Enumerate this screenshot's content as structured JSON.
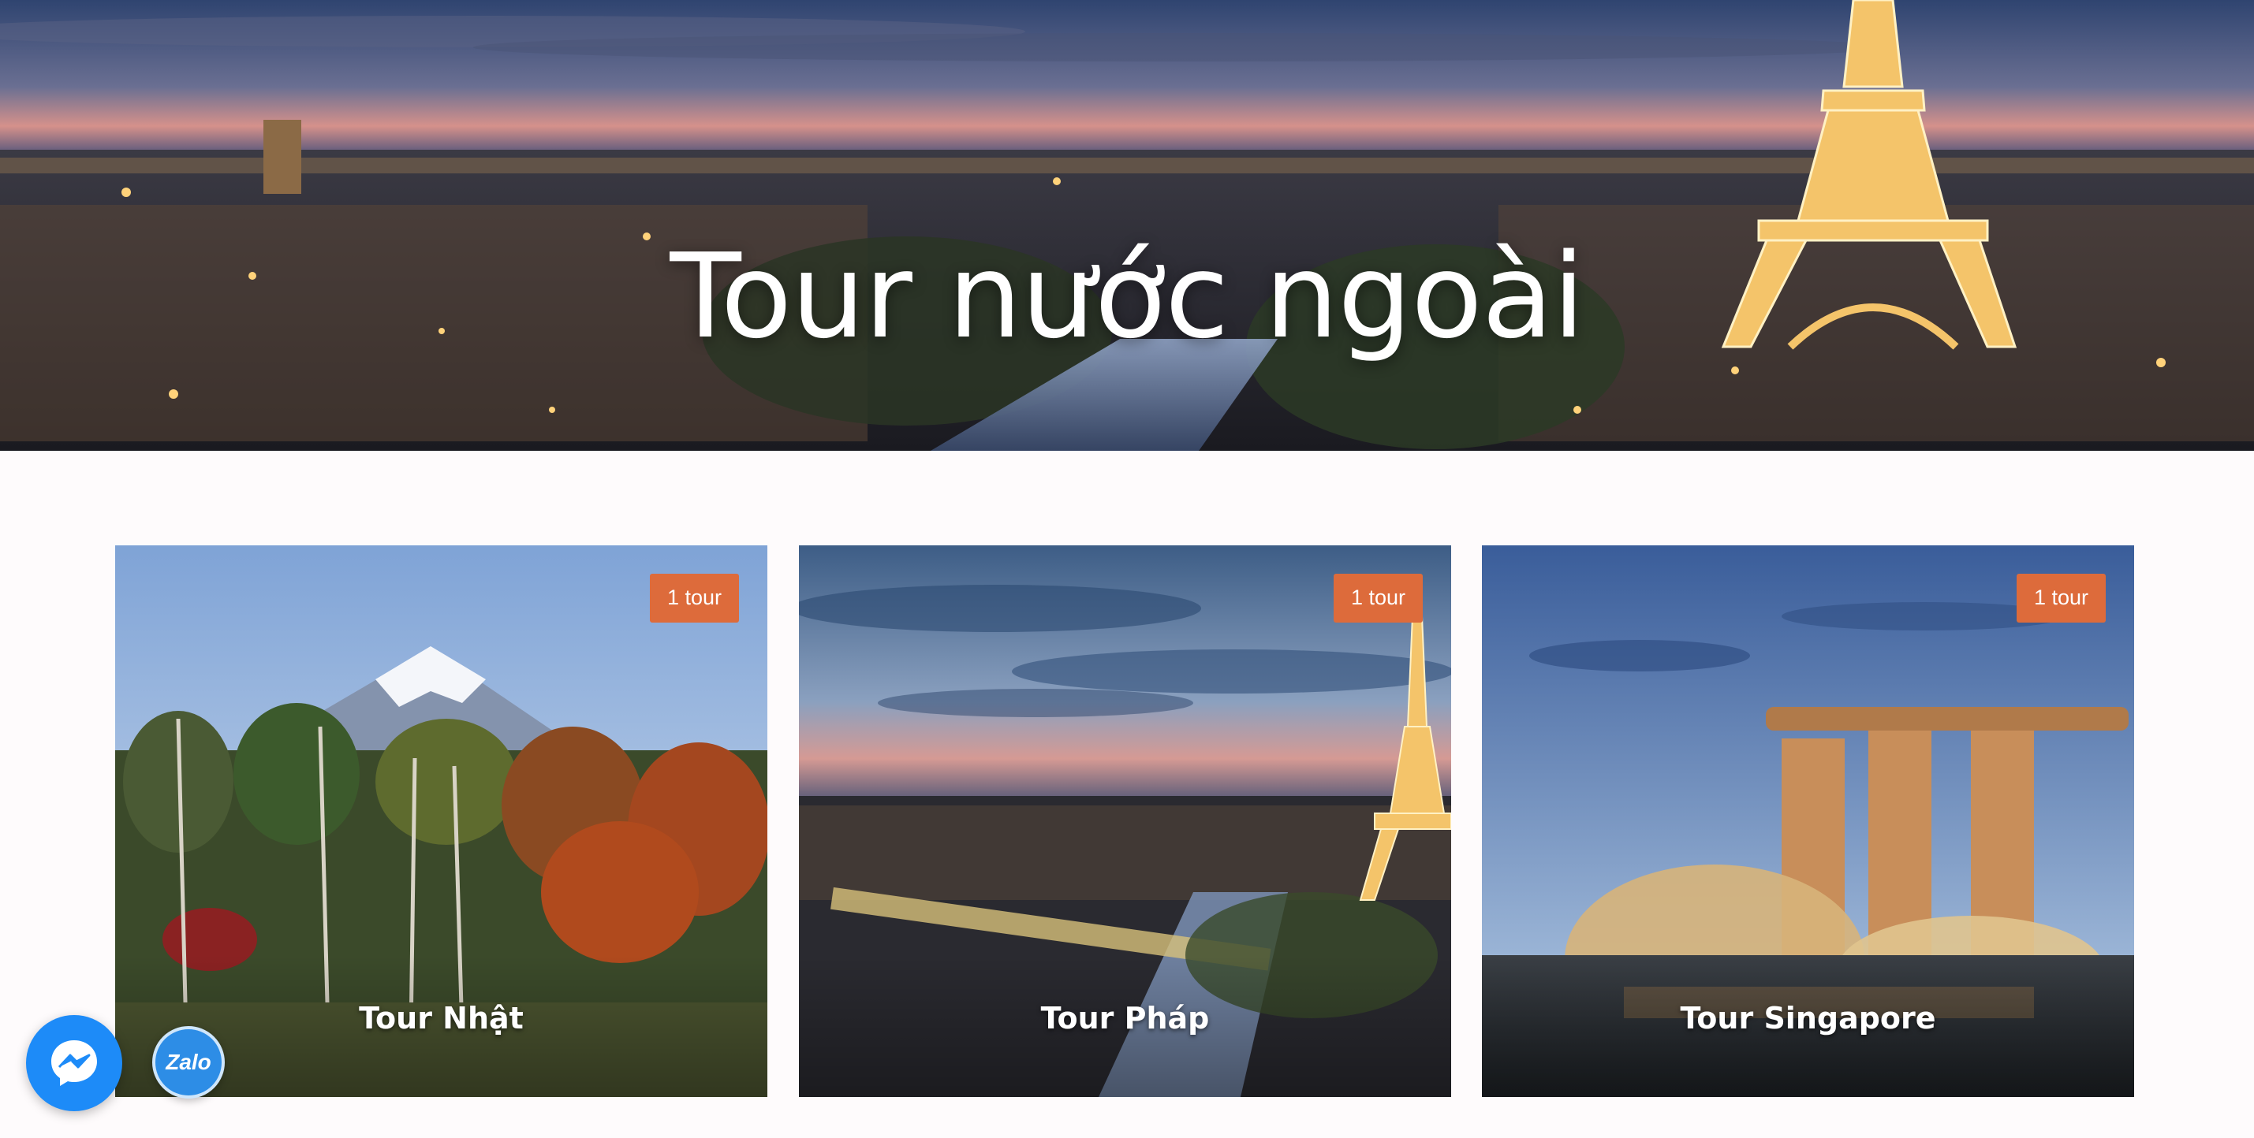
{
  "hero": {
    "title": "Tour nước ngoài",
    "image_icon": "paris-skyline-image"
  },
  "cards": [
    {
      "title": "Tour Nhật",
      "badge": "1 tour",
      "image_icon": "mount-fuji-image"
    },
    {
      "title": "Tour Pháp",
      "badge": "1 tour",
      "image_icon": "eiffel-tower-image"
    },
    {
      "title": "Tour Singapore",
      "badge": "1 tour",
      "image_icon": "marina-bay-sands-image"
    }
  ],
  "floating": {
    "messenger_icon": "messenger-icon",
    "zalo_label": "Zalo"
  },
  "colors": {
    "badge": "#dd6b3b",
    "page_background": "#fefbfc",
    "messenger": "#1d8bf8",
    "zalo": "#2d8de6"
  }
}
